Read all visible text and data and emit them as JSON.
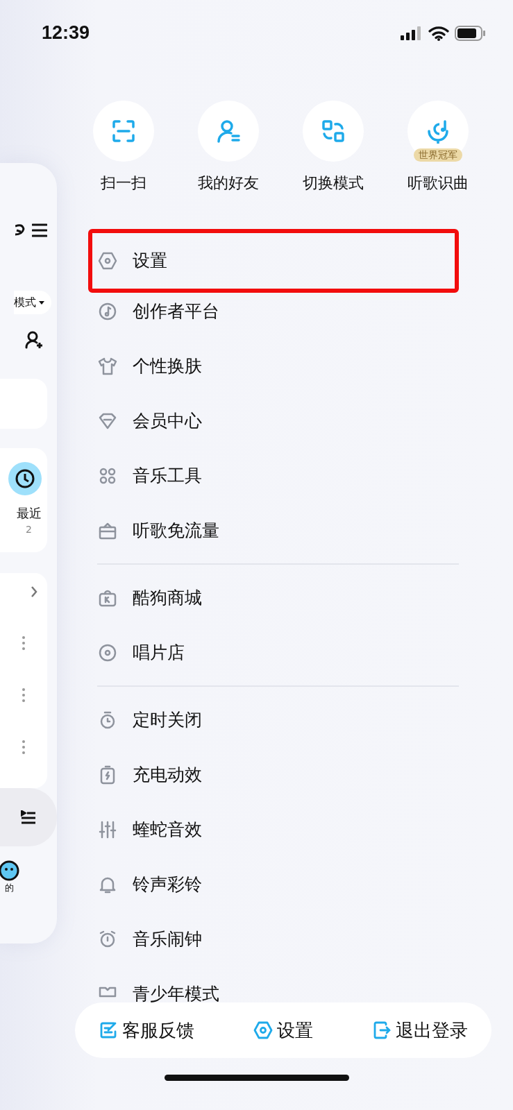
{
  "status_bar": {
    "time": "12:39"
  },
  "background_app": {
    "mode_button": "模式",
    "recent": {
      "label": "最近",
      "count": "2"
    },
    "tab_label": "的"
  },
  "quick_actions": [
    {
      "label": "扫一扫"
    },
    {
      "label": "我的好友"
    },
    {
      "label": "切换模式"
    },
    {
      "label": "听歌识曲",
      "badge": "世界冠军"
    }
  ],
  "menu_groups": [
    {
      "items": [
        {
          "label": "设置",
          "highlighted": true
        },
        {
          "label": "创作者平台",
          "highlighted": false
        },
        {
          "label": "个性换肤",
          "highlighted": false
        },
        {
          "label": "会员中心",
          "highlighted": false
        },
        {
          "label": "音乐工具",
          "highlighted": false
        },
        {
          "label": "听歌免流量",
          "highlighted": false
        }
      ]
    },
    {
      "items": [
        {
          "label": "酷狗商城",
          "highlighted": false
        },
        {
          "label": "唱片店",
          "highlighted": false
        }
      ]
    },
    {
      "items": [
        {
          "label": "定时关闭",
          "highlighted": false
        },
        {
          "label": "充电动效",
          "highlighted": false
        },
        {
          "label": "蝰蛇音效",
          "highlighted": false
        },
        {
          "label": "铃声彩铃",
          "highlighted": false
        },
        {
          "label": "音乐闹钟",
          "highlighted": false
        },
        {
          "label": "青少年模式",
          "highlighted": false
        }
      ]
    }
  ],
  "bottom_bar": [
    {
      "label": "客服反馈"
    },
    {
      "label": "设置"
    },
    {
      "label": "退出登录"
    }
  ]
}
